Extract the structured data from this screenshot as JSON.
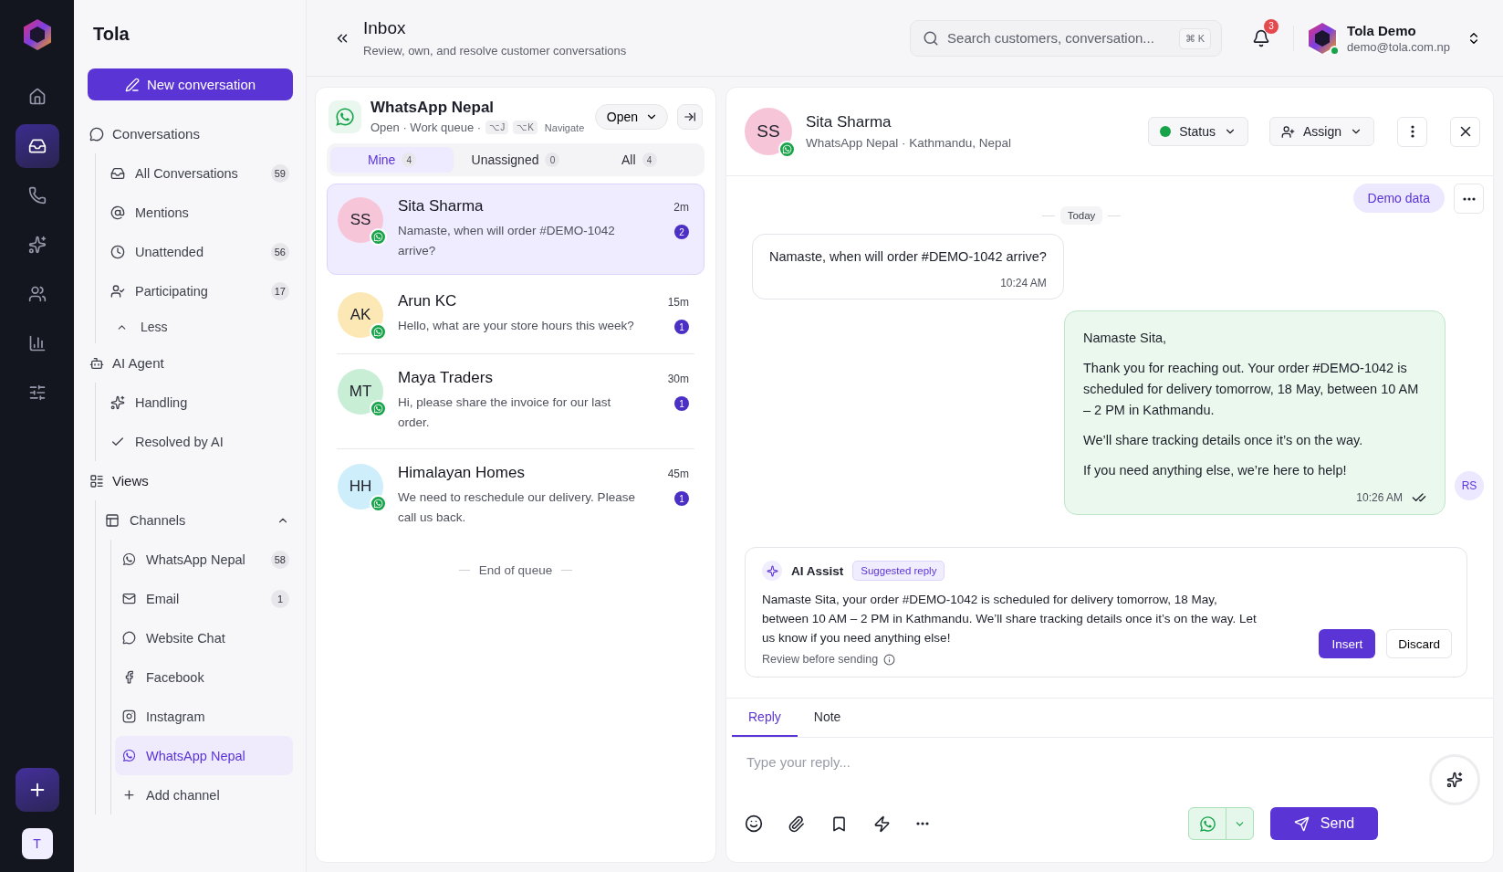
{
  "rail": {
    "items": [
      {
        "selected": false
      },
      {
        "selected": true
      },
      {
        "selected": false
      },
      {
        "selected": false
      },
      {
        "selected": false
      },
      {
        "selected": false
      },
      {
        "selected": false
      }
    ],
    "avatar": "T"
  },
  "sidebar": {
    "brand": "Tola",
    "new_button": "New conversation",
    "sections": [
      {
        "title": "Conversations",
        "items": [
          {
            "label": "All Conversations",
            "count": "59"
          },
          {
            "label": "Mentions"
          },
          {
            "label": "Unattended",
            "count": "56"
          },
          {
            "label": "Participating",
            "count": "17"
          }
        ],
        "toggle": "Less",
        "expanded": true
      },
      {
        "title": "AI Agent",
        "items": [
          {
            "label": "Handling"
          },
          {
            "label": "Resolved by AI"
          }
        ]
      },
      {
        "title": "Views",
        "items": [
          {
            "label": "Channels",
            "expanded": true,
            "children": [
              {
                "label": "WhatsApp Nepal",
                "kind": "whatsapp",
                "count": "58",
                "selected": false
              },
              {
                "label": "Email",
                "kind": "email",
                "count": "1",
                "selected": false
              },
              {
                "label": "Website Chat",
                "kind": "chat",
                "selected": false
              },
              {
                "label": "Facebook",
                "kind": "facebook",
                "selected": false
              },
              {
                "label": "Instagram",
                "kind": "instagram",
                "selected": false
              },
              {
                "label": "WhatsApp Nepal",
                "kind": "whatsapp",
                "selected": true
              },
              {
                "label": "Add channel",
                "kind": "add",
                "selected": false
              }
            ]
          }
        ]
      }
    ]
  },
  "header": {
    "title": "Inbox",
    "subtitle": "Review, own, and resolve customer conversations",
    "search": {
      "placeholder": "Search customers, conversation...",
      "shortcut": "⌘ K"
    },
    "notifications": "3",
    "user": {
      "name": "Tola Demo",
      "email": "demo@tola.com.np",
      "online": true
    }
  },
  "queue": {
    "channel": "WhatsApp Nepal",
    "meta": "Open · Work queue ·",
    "keys": [
      "⌥J",
      "⌥K"
    ],
    "keys_label": "Navigate",
    "status": "Open",
    "tabs": [
      {
        "label": "Mine",
        "count": "4",
        "selected": true
      },
      {
        "label": "Unassigned",
        "count": "0",
        "selected": false
      },
      {
        "label": "All",
        "count": "4",
        "selected": false
      }
    ],
    "conversations": [
      {
        "initials": "SS",
        "name": "Sita Sharma",
        "preview": "Namaste, when will order #DEMO-1042 arrive?",
        "time": "2m",
        "unread": "2",
        "color": "#f7c5d8",
        "selected": true
      },
      {
        "initials": "AK",
        "name": "Arun KC",
        "preview": "Hello, what are your store hours this week?",
        "time": "15m",
        "unread": "1",
        "color": "#fbe8b5",
        "selected": false
      },
      {
        "initials": "MT",
        "name": "Maya Traders",
        "preview": "Hi, please share the invoice for our last order.",
        "time": "30m",
        "unread": "1",
        "color": "#c8eed6",
        "selected": false
      },
      {
        "initials": "HH",
        "name": "Himalayan Homes",
        "preview": "We need to reschedule our delivery. Please call us back.",
        "time": "45m",
        "unread": "1",
        "color": "#cdeefa",
        "selected": false
      }
    ],
    "footer": "End of queue"
  },
  "chat": {
    "contact": {
      "initials": "SS",
      "name": "Sita Sharma",
      "meta": "WhatsApp Nepal · Kathmandu, Nepal",
      "color": "#f7c5d8"
    },
    "status": {
      "label": "Status",
      "color": "#16a34a"
    },
    "assign": "Assign",
    "badge": "Demo data",
    "date": "Today",
    "messages": [
      {
        "kind": "incoming",
        "paragraphs": [
          "Namaste, when will order #DEMO-1042 arrive?"
        ],
        "time": "10:24 AM"
      },
      {
        "kind": "outgoing",
        "paragraphs": [
          "Namaste Sita,",
          "Thank you for reaching out. Your order #DEMO-1042 is scheduled for delivery tomorrow, 18 May, between 10 AM – 2 PM in Kathmandu.",
          "We’ll share tracking details once it’s on the way.",
          "If you need anything else, we’re here to help!"
        ],
        "time": "10:26 AM",
        "read": true,
        "agent": "RS"
      }
    ],
    "ai_assist": {
      "title": "AI Assist",
      "tag": "Suggested reply",
      "text": "Namaste Sita, your order #DEMO-1042 is scheduled for delivery tomorrow, 18 May, between 10 AM – 2 PM in Kathmandu. We’ll share tracking details once it’s on the way. Let us know if you need anything else!",
      "note": "Review before sending",
      "insert": "Insert",
      "discard": "Discard"
    },
    "composer": {
      "tabs": [
        {
          "label": "Reply",
          "selected": true
        },
        {
          "label": "Note",
          "selected": false
        }
      ],
      "placeholder": "Type your reply...",
      "send": "Send"
    }
  }
}
